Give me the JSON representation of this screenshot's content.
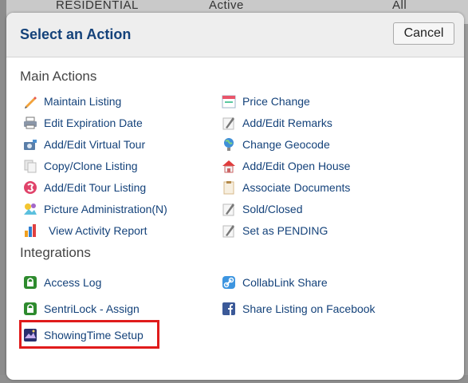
{
  "background": {
    "fragments": [
      "RESIDENTIAL",
      "Active",
      "All"
    ]
  },
  "dialog": {
    "title": "Select an Action",
    "cancel_label": "Cancel"
  },
  "main_actions": {
    "heading": "Main Actions",
    "left": [
      {
        "label": "Maintain Listing",
        "icon": "pencil-icon"
      },
      {
        "label": "Edit Expiration Date",
        "icon": "printer-icon"
      },
      {
        "label": "Add/Edit Virtual Tour",
        "icon": "camera-icon"
      },
      {
        "label": "Copy/Clone Listing",
        "icon": "copy-icon"
      },
      {
        "label": "Add/Edit Tour Listing",
        "icon": "tour-icon"
      },
      {
        "label": "Picture Administration(N)",
        "icon": "picture-admin-icon"
      },
      {
        "label": "View Activity Report",
        "icon": "report-chart-icon"
      }
    ],
    "right": [
      {
        "label": "Price Change",
        "icon": "calendar-icon"
      },
      {
        "label": "Add/Edit Remarks",
        "icon": "edit-note-icon"
      },
      {
        "label": "Change Geocode",
        "icon": "globe-icon"
      },
      {
        "label": "Add/Edit Open House",
        "icon": "house-icon"
      },
      {
        "label": "Associate Documents",
        "icon": "document-icon"
      },
      {
        "label": "Sold/Closed",
        "icon": "edit-note-icon"
      },
      {
        "label": "Set as PENDING",
        "icon": "edit-note-icon"
      }
    ]
  },
  "integrations": {
    "heading": "Integrations",
    "left": [
      {
        "label": "Access Log",
        "icon": "lock-icon"
      },
      {
        "label": "SentriLock - Assign",
        "icon": "lock-icon"
      },
      {
        "label": "ShowingTime Setup",
        "icon": "showingtime-icon",
        "highlighted": true
      }
    ],
    "right": [
      {
        "label": "CollabLink Share",
        "icon": "link-icon"
      },
      {
        "label": "Share Listing on Facebook",
        "icon": "facebook-icon"
      }
    ]
  },
  "colors": {
    "link": "#14427a",
    "highlight": "#e01b1b",
    "lock_green": "#2e8b2e",
    "facebook_blue": "#3b5998"
  }
}
